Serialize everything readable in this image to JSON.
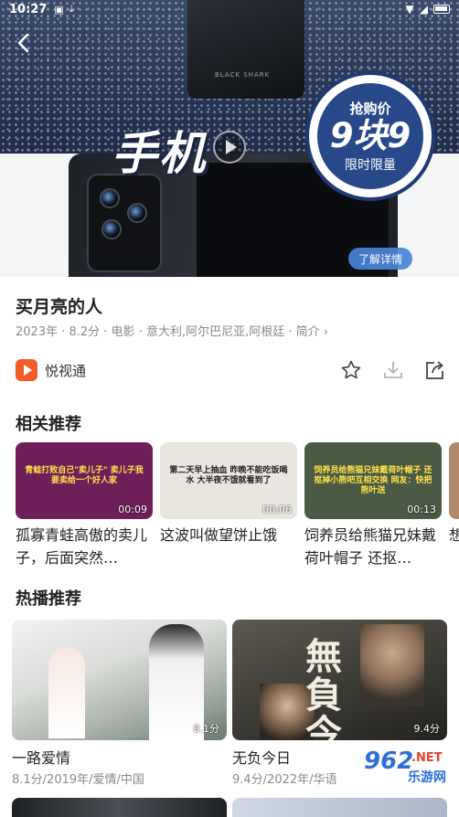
{
  "status_bar": {
    "time": "10:27"
  },
  "hero": {
    "big_text": "手机",
    "phone_brand": "BLACK SHARK",
    "seal": {
      "line1": "抢购价",
      "line2": "9块9",
      "line3": "限时限量"
    },
    "more_label": "了解详情"
  },
  "detail": {
    "title": "买月亮的人",
    "meta": "2023年 · 8.2分 · 电影 · 意大利,阿尔巴尼亚,阿根廷 · 简介 ›",
    "source_name": "悦视通"
  },
  "related": {
    "title": "相关推荐",
    "items": [
      {
        "title": "孤寡青蛙高傲的卖儿子，后面突然…",
        "duration": "00:09",
        "caption": "青蛙打败自己\"卖儿子\" 卖儿子我要卖给一个好人家",
        "thumb_bg": "#6e1f5a",
        "caption_color": "#ffe24a"
      },
      {
        "title": "这波叫做望饼止饿",
        "duration": "00:06",
        "caption": "第二天早上抽血 昨晚不能吃饭喝水 大半夜不饿就看到了",
        "thumb_bg": "#e9e6e0",
        "caption_color": "#222222"
      },
      {
        "title": "饲养员给熊猫兄妹戴荷叶帽子 还抠…",
        "duration": "00:13",
        "caption": "饲养员给熊猫兄妹戴荷叶帽子 还抠掉小熊吧互相交换 网友：快把熊叶送",
        "thumb_bg": "#4a5a44",
        "caption_color": "#ffe24a"
      },
      {
        "title": "想…",
        "duration": "",
        "caption": "",
        "thumb_bg": "#b08a6a",
        "caption_color": "#ffffff"
      }
    ]
  },
  "hot": {
    "title": "热播推荐",
    "items": [
      {
        "title": "一路爱情",
        "sub": "8.1分/2019年/爱情/中国",
        "score": "8.1分"
      },
      {
        "title": "无负今日",
        "sub": "9.4分/2022年/华语",
        "score": "9.4分",
        "poster_text": "無負今"
      }
    ]
  },
  "watermark": {
    "big": "962",
    "net": ".NET",
    "sub": "乐游网"
  }
}
